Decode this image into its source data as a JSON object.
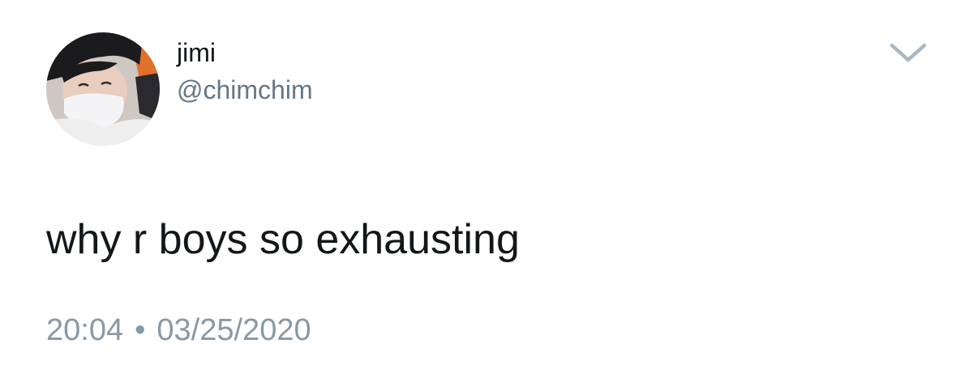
{
  "tweet": {
    "author": {
      "display_name": "jimi",
      "handle": "@chimchim",
      "avatar_icon": "profile-photo"
    },
    "text": "why r boys so exhausting",
    "time": "20:04",
    "separator": "•",
    "date": "03/25/2020",
    "menu_icon": "chevron-down-icon"
  },
  "colors": {
    "text_primary": "#14171a",
    "text_secondary": "#657786",
    "text_meta": "#8899a6",
    "chevron": "#aab8c2"
  }
}
